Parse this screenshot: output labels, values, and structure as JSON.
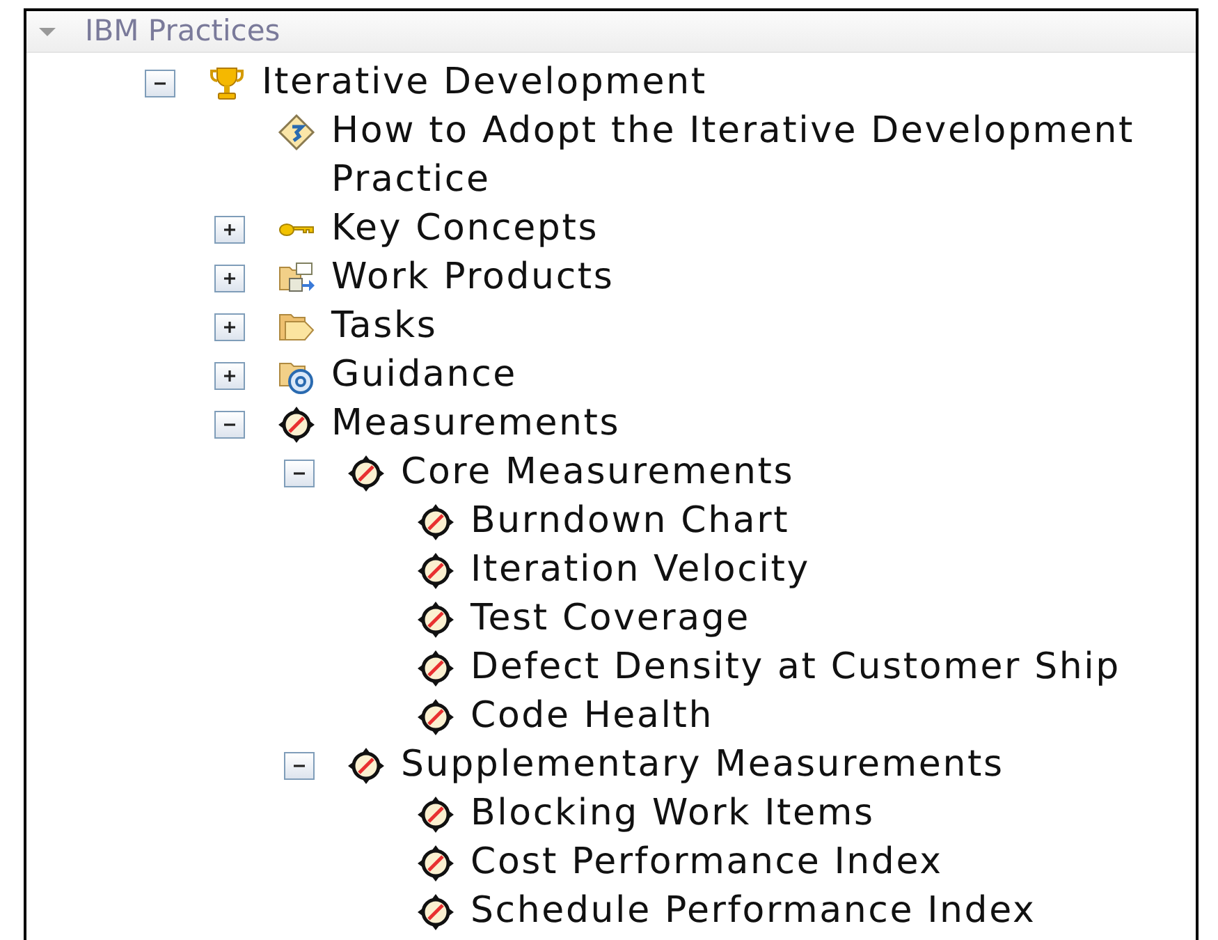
{
  "header": {
    "title": "IBM Practices",
    "expanded": true
  },
  "tree": [
    {
      "label": "Iterative Development",
      "kind": "trophy",
      "expanded": true,
      "children": [
        {
          "label": "How to Adopt the Iterative Development Practice",
          "kind": "guide"
        },
        {
          "label": "Key Concepts",
          "kind": "key",
          "expanded": false
        },
        {
          "label": "Work Products",
          "kind": "workproducts",
          "expanded": false
        },
        {
          "label": "Tasks",
          "kind": "tasks",
          "expanded": false
        },
        {
          "label": "Guidance",
          "kind": "guidance",
          "expanded": false
        },
        {
          "label": "Measurements",
          "kind": "measure",
          "expanded": true,
          "children": [
            {
              "label": "Core Measurements",
              "kind": "measure",
              "expanded": true,
              "children": [
                {
                  "label": "Burndown Chart",
                  "kind": "measure"
                },
                {
                  "label": "Iteration Velocity",
                  "kind": "measure"
                },
                {
                  "label": "Test Coverage",
                  "kind": "measure"
                },
                {
                  "label": "Defect Density at Customer Ship",
                  "kind": "measure"
                },
                {
                  "label": "Code Health",
                  "kind": "measure"
                }
              ]
            },
            {
              "label": "Supplementary Measurements",
              "kind": "measure",
              "expanded": true,
              "children": [
                {
                  "label": "Blocking Work Items",
                  "kind": "measure"
                },
                {
                  "label": "Cost Performance Index",
                  "kind": "measure"
                },
                {
                  "label": "Schedule Performance Index",
                  "kind": "measure"
                }
              ]
            }
          ]
        }
      ]
    }
  ]
}
